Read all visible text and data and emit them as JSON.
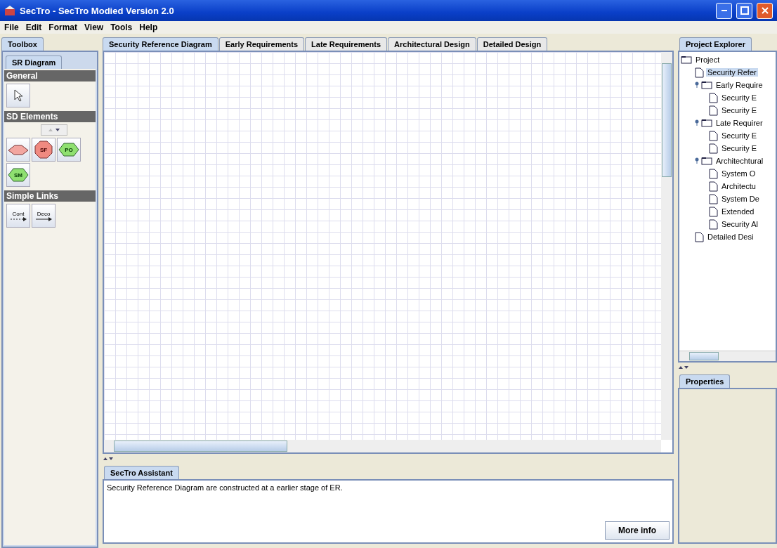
{
  "window": {
    "title": "SecTro - SecTro Modied Version 2.0"
  },
  "menu": [
    "File",
    "Edit",
    "Format",
    "View",
    "Tools",
    "Help"
  ],
  "toolbox": {
    "tab": "Toolbox",
    "subtab": "SR Diagram",
    "sections": [
      {
        "title": "General",
        "items": [
          {
            "kind": "pointer"
          }
        ]
      },
      {
        "title": "SD Elements",
        "scroller": true,
        "items": [
          {
            "kind": "pentagon"
          },
          {
            "kind": "octagon",
            "label": "SF"
          },
          {
            "kind": "hexagon",
            "label": "PO"
          },
          {
            "kind": "hexagon",
            "label": "SM"
          }
        ]
      },
      {
        "title": "Simple Links",
        "items": [
          {
            "kind": "link",
            "label": "Cont",
            "dashed": true
          },
          {
            "kind": "link",
            "label": "Deco",
            "dashed": false
          }
        ]
      }
    ]
  },
  "tabs": [
    {
      "label": "Security Reference Diagram",
      "selected": true
    },
    {
      "label": "Early Requirements",
      "selected": false
    },
    {
      "label": "Late Requirements",
      "selected": false
    },
    {
      "label": "Architectural Design",
      "selected": false
    },
    {
      "label": "Detailed Design",
      "selected": false
    }
  ],
  "assistant": {
    "tab": "SecTro Assistant",
    "text": "Security Reference Diagram are constructed at a earlier stage of ER.",
    "button": "More info"
  },
  "explorer": {
    "tab": "Project Explorer",
    "tree": [
      {
        "kind": "folder",
        "label": "Project",
        "selected": false,
        "children": [
          {
            "kind": "document",
            "label": "Security Refer",
            "selected": true
          },
          {
            "kind": "folder",
            "label": "Early Require",
            "selected": false,
            "expanded": true,
            "children": [
              {
                "kind": "document",
                "label": "Security E",
                "selected": false
              },
              {
                "kind": "document",
                "label": "Security E",
                "selected": false
              }
            ]
          },
          {
            "kind": "folder",
            "label": "Late Requirer",
            "selected": false,
            "expanded": true,
            "children": [
              {
                "kind": "document",
                "label": "Security E",
                "selected": false
              },
              {
                "kind": "document",
                "label": "Security E",
                "selected": false
              }
            ]
          },
          {
            "kind": "folder",
            "label": "Architechtural",
            "selected": false,
            "expanded": true,
            "children": [
              {
                "kind": "document",
                "label": "System O",
                "selected": false
              },
              {
                "kind": "document",
                "label": "Architectu",
                "selected": false
              },
              {
                "kind": "document",
                "label": "System De",
                "selected": false
              },
              {
                "kind": "document",
                "label": "Extended",
                "selected": false
              },
              {
                "kind": "document",
                "label": "Security Al",
                "selected": false
              }
            ]
          },
          {
            "kind": "document",
            "label": "Detailed Desi",
            "selected": false
          }
        ]
      }
    ]
  },
  "properties": {
    "tab": "Properties"
  }
}
